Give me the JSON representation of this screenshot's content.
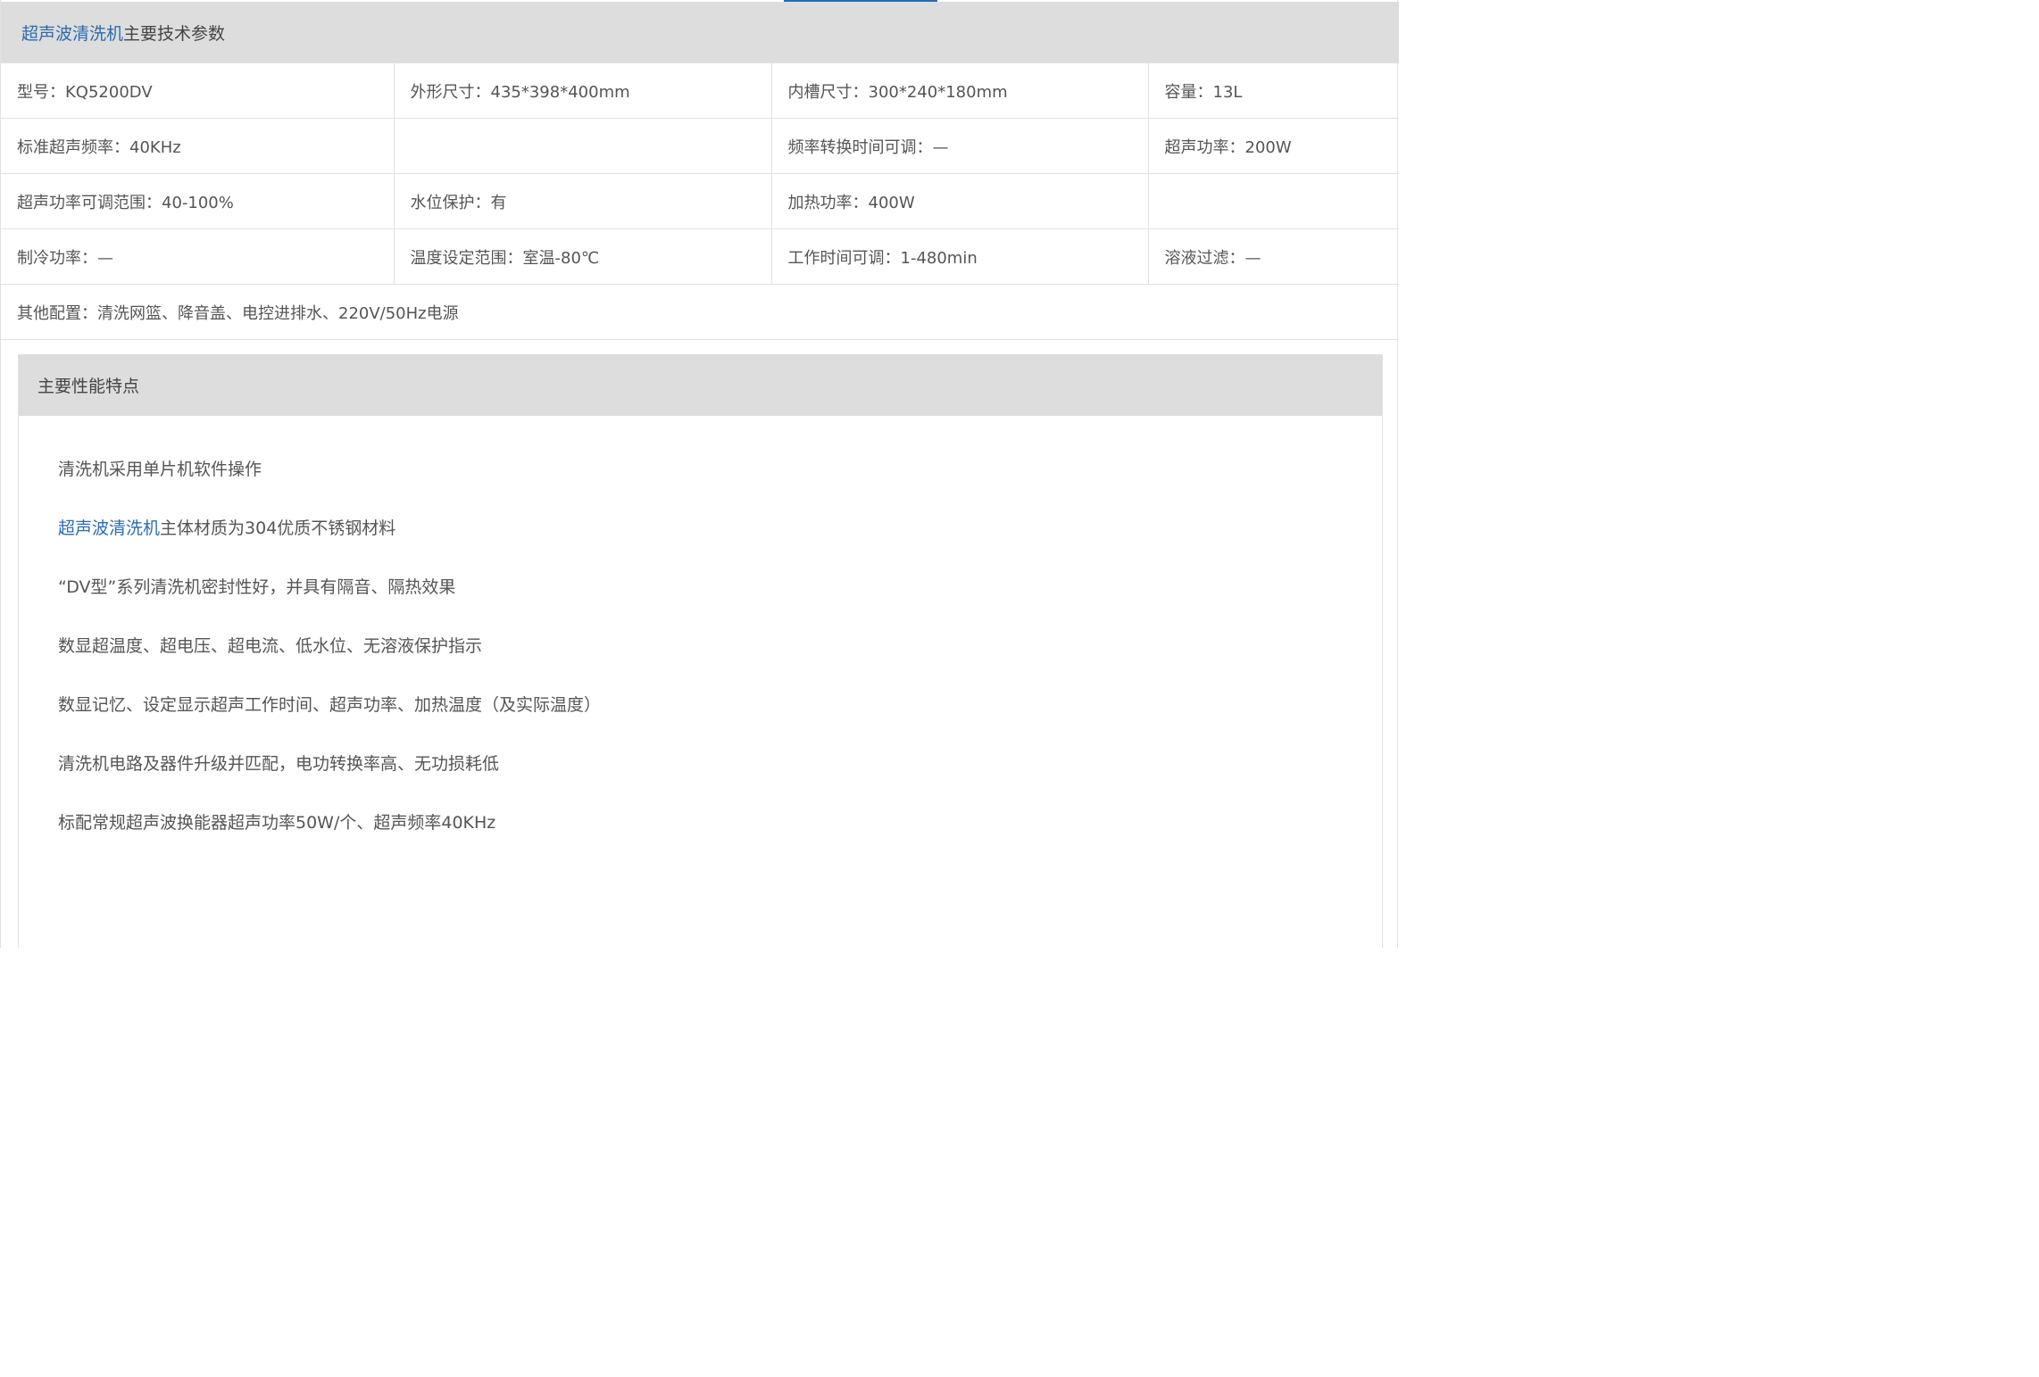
{
  "spec": {
    "title_link": "超声波清洗机",
    "title_rest": "主要技术参数",
    "rows": [
      [
        "型号：KQ5200DV",
        "外形尺寸：435*398*400mm",
        "内槽尺寸：300*240*180mm",
        "容量：13L"
      ],
      [
        "标准超声频率：40KHz",
        "",
        "频率转换时间可调：—",
        "超声功率：200W"
      ],
      [
        "超声功率可调范围：40-100%",
        "水位保护：有",
        "加热功率：400W",
        ""
      ],
      [
        "制冷功率：—",
        "温度设定范围：室温-80℃",
        "工作时间可调：1-480min",
        "溶液过滤：—"
      ]
    ],
    "other_config": "其他配置：清洗网篮、降音盖、电控进排水、220V/50Hz电源"
  },
  "features": {
    "title": "主要性能特点",
    "items": [
      {
        "link": "",
        "text": "清洗机采用单片机软件操作"
      },
      {
        "link": "超声波清洗机",
        "text": "主体材质为304优质不锈钢材料"
      },
      {
        "link": "",
        "text": "“DV型”系列清洗机密封性好，并具有隔音、隔热效果"
      },
      {
        "link": "",
        "text": "数显超温度、超电压、超电流、低水位、无溶液保护指示"
      },
      {
        "link": "",
        "text": "数显记忆、设定显示超声工作时间、超声功率、加热温度（及实际温度）"
      },
      {
        "link": "",
        "text": "清洗机电路及器件升级并匹配，电功转换率高、无功损耗低"
      },
      {
        "link": "",
        "text": "标配常规超声波换能器超声功率50W/个、超声频率40KHz"
      }
    ]
  },
  "colors": {
    "link": "#2b6cb0",
    "header_bg": "#dddddd",
    "border": "#e2e2e2",
    "text": "#555555"
  }
}
